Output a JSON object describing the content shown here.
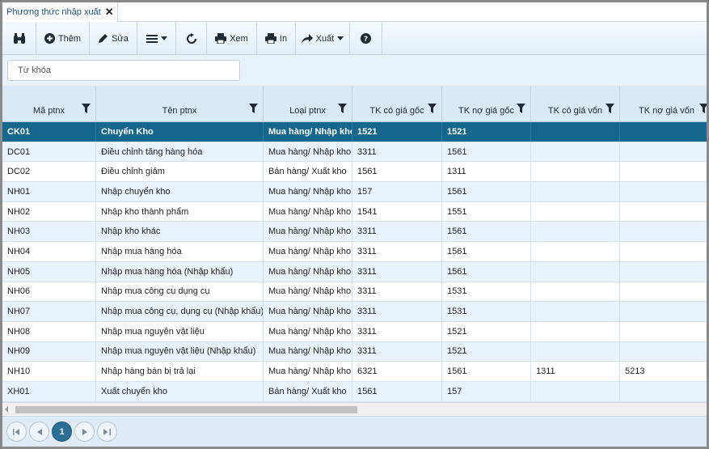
{
  "tab": {
    "title": "Phương thức nhập xuất"
  },
  "toolbar": {
    "add_label": "Thêm",
    "edit_label": "Sửa",
    "view_label": "Xem",
    "print_label": "In",
    "export_label": "Xuất"
  },
  "search": {
    "placeholder": "Từ khóa",
    "value": ""
  },
  "columns": [
    "Mã ptnx",
    "Tên ptnx",
    "Loại ptnx",
    "TK có giá gốc",
    "TK nợ giá gốc",
    "TK có giá vốn",
    "TK nợ giá vốn"
  ],
  "rows": [
    [
      "CK01",
      "Chuyển Kho",
      "Mua hàng/ Nhập kho",
      "1521",
      "1521",
      "",
      ""
    ],
    [
      "DC01",
      "Điều chỉnh tăng hàng hóa",
      "Mua hàng/ Nhập kho",
      "3311",
      "1561",
      "",
      ""
    ],
    [
      "DC02",
      "Điều chỉnh giảm",
      "Bán hàng/ Xuất kho",
      "1561",
      "1311",
      "",
      ""
    ],
    [
      "NH01",
      "Nhập chuyển kho",
      "Mua hàng/ Nhập kho",
      "157",
      "1561",
      "",
      ""
    ],
    [
      "NH02",
      "Nhập kho thành phẩm",
      "Mua hàng/ Nhập kho",
      "1541",
      "1551",
      "",
      ""
    ],
    [
      "NH03",
      "Nhập kho khác",
      "Mua hàng/ Nhập kho",
      "3311",
      "1561",
      "",
      ""
    ],
    [
      "NH04",
      "Nhập mua hàng hóa",
      "Mua hàng/ Nhập kho",
      "3311",
      "1561",
      "",
      ""
    ],
    [
      "NH05",
      "Nhập mua hàng hóa (Nhập khẩu)",
      "Mua hàng/ Nhập kho",
      "3311",
      "1561",
      "",
      ""
    ],
    [
      "NH06",
      "Nhập mua công cụ dụng cụ",
      "Mua hàng/ Nhập kho",
      "3311",
      "1531",
      "",
      ""
    ],
    [
      "NH07",
      "Nhập mua công cụ, dụng cụ (Nhập khẩu)",
      "Mua hàng/ Nhập kho",
      "3311",
      "1531",
      "",
      ""
    ],
    [
      "NH08",
      "Nhập mua nguyên vật liệu",
      "Mua hàng/ Nhập kho",
      "3311",
      "1521",
      "",
      ""
    ],
    [
      "NH09",
      "Nhập mua nguyên vật liệu (Nhập khẩu)",
      "Mua hàng/ Nhập kho",
      "3311",
      "1521",
      "",
      ""
    ],
    [
      "NH10",
      "Nhập hàng bán bị trả lại",
      "Mua hàng/ Nhập kho",
      "6321",
      "1561",
      "1311",
      "5213"
    ],
    [
      "XH01",
      "Xuất chuyển kho",
      "Bán hàng/ Xuất kho",
      "1561",
      "157",
      "",
      ""
    ]
  ],
  "selected_row": 0,
  "pager": {
    "current_page": "1"
  },
  "colors": {
    "selected_row": "#15678d",
    "header_bg": "#d9e9f5",
    "alt_row": "#e9f2fa",
    "accent": "#2b6f96"
  }
}
